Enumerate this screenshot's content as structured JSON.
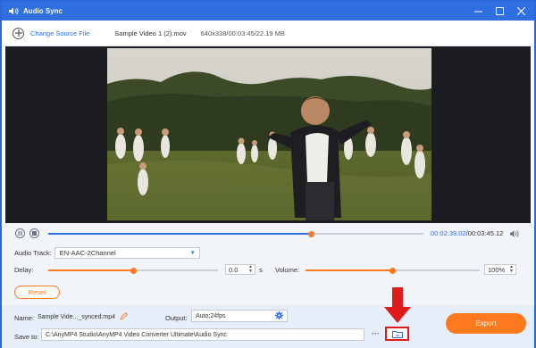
{
  "window": {
    "title": "Audio Sync"
  },
  "toolbar": {
    "change_source_label": "Change Source File",
    "file_name": "Sample Video 1 (2).mov",
    "file_meta": "640x338/00:03:45/22.19 MB"
  },
  "player": {
    "current_time": "00:02:39.02",
    "total_time": "/00:03:45.12",
    "progress": 0.7
  },
  "audio": {
    "track_label": "Audio Track:",
    "track_value": "EN-AAC-2Channel",
    "delay_label": "Delay:",
    "delay_value": "0.0",
    "delay_unit": "s",
    "delay_level": 0.5,
    "volume_label": "Volume:",
    "volume_value": "100%",
    "volume_level": 0.5,
    "reset_label": "Reset"
  },
  "output": {
    "name_label": "Name:",
    "name_value": "Sample Vide..._synced.mp4",
    "output_label": "Output:",
    "output_value": "Auto;24fps",
    "save_to_label": "Save to:",
    "save_path": "C:\\AnyMP4 Studio\\AnyMP4 Video Converter Ultimate\\Audio Sync",
    "more_label": "···",
    "export_label": "Export"
  },
  "colors": {
    "accent": "#2f6fe0",
    "orange": "#ff7a1f",
    "highlight": "#e01b1b"
  }
}
